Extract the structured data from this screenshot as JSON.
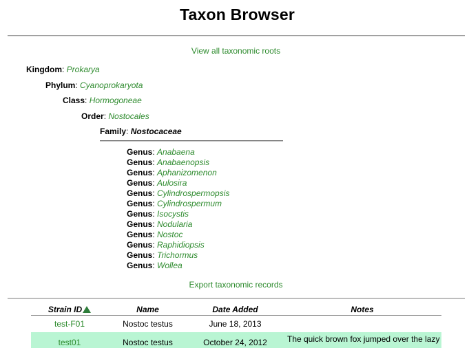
{
  "header": {
    "title": "Taxon Browser"
  },
  "nav": {
    "roots_link": "View all taxonomic roots",
    "export_link": "Export taxonomic records"
  },
  "lineage": {
    "kingdom": {
      "label": "Kingdom",
      "value": "Prokarya"
    },
    "phylum": {
      "label": "Phylum",
      "value": "Cyanoprokaryota"
    },
    "class": {
      "label": "Class",
      "value": "Hormogoneae"
    },
    "order": {
      "label": "Order",
      "value": "Nostocales"
    },
    "family": {
      "label": "Family",
      "value": "Nostocaceae"
    }
  },
  "genera": {
    "label": "Genus",
    "items": [
      "Anabaena",
      "Anabaenopsis",
      "Aphanizomenon",
      "Aulosira",
      "Cylindrospermopsis",
      "Cylindrospermum",
      "Isocystis",
      "Nodularia",
      "Nostoc",
      "Raphidiopsis",
      "Trichormus",
      "Wollea"
    ]
  },
  "strains_table": {
    "columns": [
      "Strain ID",
      "Name",
      "Date Added",
      "Notes"
    ],
    "sort_icon": "sort-ascending-icon",
    "rows": [
      {
        "strain_id": "test-F01",
        "name": "Nostoc testus",
        "date_added": "June 18, 2013",
        "notes": ""
      },
      {
        "strain_id": "test01",
        "name": "Nostoc testus",
        "date_added": "October 24, 2012",
        "notes": "The quick brown fox jumped over the lazy"
      }
    ]
  },
  "colors": {
    "link": "#2e8b2e",
    "row_highlight": "#b9f5d3"
  }
}
